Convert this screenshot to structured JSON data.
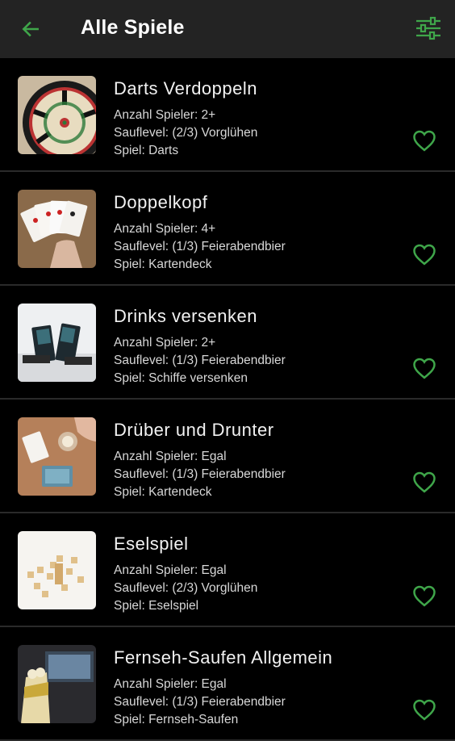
{
  "header": {
    "title": "Alle Spiele"
  },
  "colors": {
    "accent": "#3fa64a",
    "appbar": "#232323",
    "background": "#000000"
  },
  "icons": {
    "back": "arrow-left-icon",
    "filter": "sliders-icon",
    "favorite": "heart-outline-icon"
  },
  "games": [
    {
      "name": "Darts Verdoppeln",
      "players": "Anzahl Spieler: 2+",
      "level": "Sauflevel: (2/3) Vorglühen",
      "game": "Spiel: Darts",
      "thumb": "darts"
    },
    {
      "name": "Doppelkopf",
      "players": "Anzahl Spieler: 4+",
      "level": "Sauflevel: (1/3) Feierabendbier",
      "game": "Spiel: Kartendeck",
      "thumb": "cards"
    },
    {
      "name": "Drinks versenken",
      "players": "Anzahl Spieler: 2+",
      "level": "Sauflevel: (1/3) Feierabendbier",
      "game": "Spiel: Schiffe versenken",
      "thumb": "battleship"
    },
    {
      "name": "Drüber und Drunter",
      "players": "Anzahl Spieler: Egal",
      "level": "Sauflevel: (1/3) Feierabendbier",
      "game": "Spiel: Kartendeck",
      "thumb": "cardtable"
    },
    {
      "name": "Eselspiel",
      "players": "Anzahl Spieler: Egal",
      "level": "Sauflevel: (2/3) Vorglühen",
      "game": "Spiel: Eselspiel",
      "thumb": "tiles"
    },
    {
      "name": "Fernseh-Saufen Allgemein",
      "players": "Anzahl Spieler: Egal",
      "level": "Sauflevel: (1/3) Feierabendbier",
      "game": "Spiel: Fernseh-Saufen",
      "thumb": "tv"
    }
  ]
}
